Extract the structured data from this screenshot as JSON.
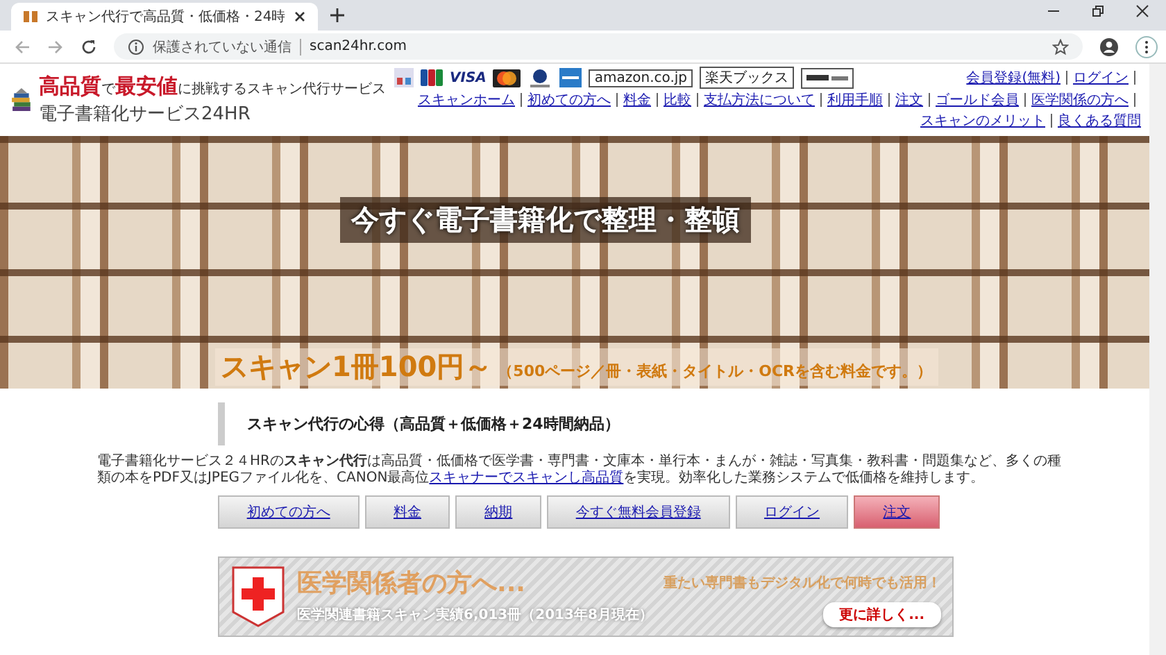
{
  "browser": {
    "tab_title": "スキャン代行で高品質・低価格・24時",
    "security": "保護されていない通信",
    "url": "scan24hr.com"
  },
  "header": {
    "tagline": "**高品質**で**最安値**に挑戦するスキャン代行サービス",
    "site_name": "電子書籍化サービス24HR",
    "card_labels": [
      "VISA"
    ],
    "store_badges": [
      "amazon.co.jp",
      "楽天ブックス"
    ],
    "account_links": [
      "会員登録(無料)",
      "ログイン"
    ],
    "nav": [
      "スキャンホーム",
      "初めての方へ",
      "料金",
      "比較",
      "支払方法について",
      "利用手順",
      "注文",
      "ゴールド会員",
      "医学関係の方へ",
      "スキャンのメリット",
      "良くある質問"
    ]
  },
  "hero": {
    "title": "今すぐ電子書籍化で整理・整頓",
    "price": "スキャン1冊100円～",
    "price_note": "（500ページ／冊・表紙・タイトル・OCRを含む料金です。）"
  },
  "section": {
    "heading": "スキャン代行の心得（高品質＋低価格＋24時間納品）",
    "body_start": "電子書籍化サービス２４HRの**スキャン代行**は高品質・低価格で医学書・専門書・文庫本・単行本・まんが・雑誌・写真集・教科書・問題集など、多くの種類の本をPDF又はJPEGファイル化を、CANON最高位",
    "body_link": "スキャナーでスキャンし高品質",
    "body_end": "を実現。効率化した業務システムで低価格を維持します。"
  },
  "buttons": [
    {
      "label": "初めての方へ",
      "kind": "normal"
    },
    {
      "label": "料金",
      "kind": "normal"
    },
    {
      "label": "納期",
      "kind": "normal"
    },
    {
      "label": "今すぐ無料会員登録",
      "kind": "normal"
    },
    {
      "label": "ログイン",
      "kind": "normal"
    },
    {
      "label": "注文",
      "kind": "highlight"
    }
  ],
  "banner": {
    "title": "医学関係者の方へ...",
    "subtitle": "重たい専門書もデジタル化で何時でも活用！",
    "stats": "医学関連書籍スキャン実績6,013冊（2013年8月現在）",
    "button": "更に詳しく..."
  }
}
